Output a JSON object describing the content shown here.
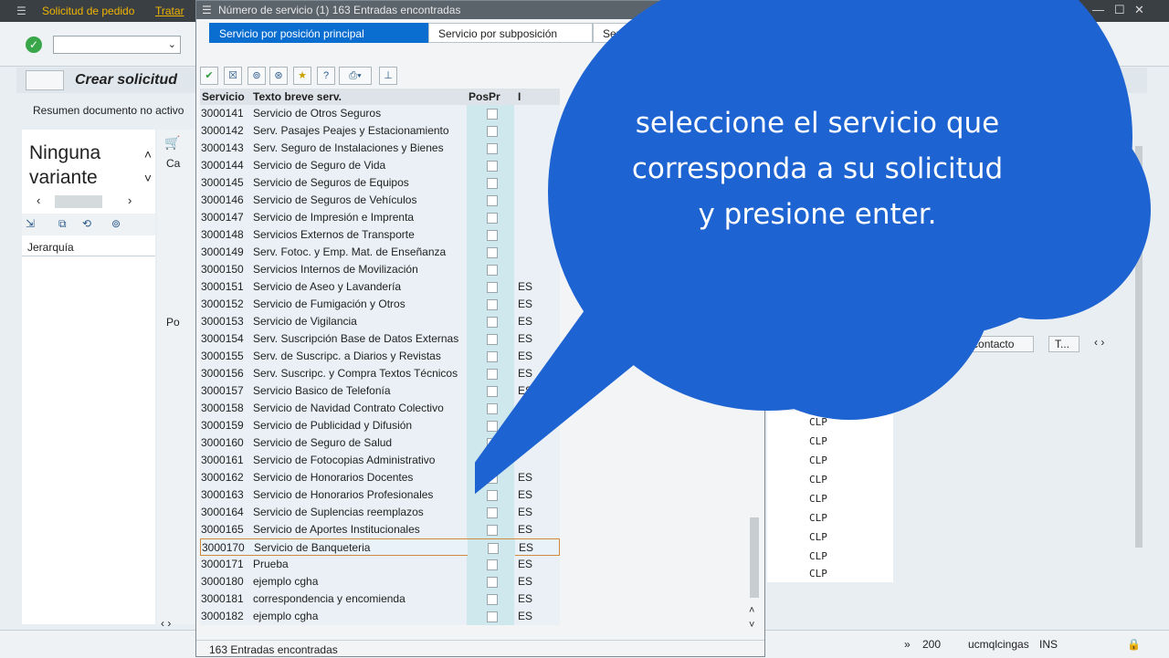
{
  "menu": {
    "items": [
      "Solicitud de pedido",
      "Tratar"
    ]
  },
  "window_controls": {
    "minimize": "—",
    "maximize": "☐",
    "close": "✕"
  },
  "main": {
    "title": "Crear solicitud",
    "summary_text": "Resumen documento no activo",
    "variant_text": "Ninguna variante",
    "hierarchy_label": "Jerarquía",
    "side_labels": [
      "Ca",
      "Po"
    ]
  },
  "right_tabs": [
    "ona de contacto",
    "T..."
  ],
  "currency_rows": [
    "CLP",
    "CLP",
    "CLP",
    "CLP",
    "CLP",
    "CLP",
    "CLP",
    "CLP",
    "CLP"
  ],
  "footer": {
    "zoom": "200",
    "user": "ucmqlcingas",
    "mode": "INS"
  },
  "dialog": {
    "title": "Número de servicio (1)  163 Entradas encontradas",
    "tabs": [
      "Servicio por posición principal",
      "Servicio por subposición",
      "Servicio por..."
    ],
    "columns": {
      "servicio": "Servicio",
      "texto": "Texto breve serv.",
      "pospr": "PosPr",
      "idioma": "I"
    },
    "rows": [
      {
        "id": "3000141",
        "text": "Servicio de Otros Seguros",
        "lang": ""
      },
      {
        "id": "3000142",
        "text": "Serv. Pasajes Peajes y Estacionamiento",
        "lang": ""
      },
      {
        "id": "3000143",
        "text": "Serv. Seguro de Instalaciones y Bienes",
        "lang": ""
      },
      {
        "id": "3000144",
        "text": "Servicio de Seguro de Vida",
        "lang": ""
      },
      {
        "id": "3000145",
        "text": "Servicio de Seguros de Equipos",
        "lang": ""
      },
      {
        "id": "3000146",
        "text": "Servicio de Seguros de Vehículos",
        "lang": ""
      },
      {
        "id": "3000147",
        "text": "Servicio de Impresión e Imprenta",
        "lang": ""
      },
      {
        "id": "3000148",
        "text": "Servicios Externos de Transporte",
        "lang": ""
      },
      {
        "id": "3000149",
        "text": "Serv. Fotoc.  y Emp. Mat.  de Enseñanza",
        "lang": ""
      },
      {
        "id": "3000150",
        "text": "Servicios Internos de Movilización",
        "lang": ""
      },
      {
        "id": "3000151",
        "text": "Servicio de Aseo y Lavandería",
        "lang": "ES"
      },
      {
        "id": "3000152",
        "text": "Servicio de Fumigación y Otros",
        "lang": "ES"
      },
      {
        "id": "3000153",
        "text": "Servicio de Vigilancia",
        "lang": "ES"
      },
      {
        "id": "3000154",
        "text": "Serv. Suscripción Base de Datos Externas",
        "lang": "ES"
      },
      {
        "id": "3000155",
        "text": "Serv. de Suscripc. a Diarios y Revistas",
        "lang": "ES"
      },
      {
        "id": "3000156",
        "text": "Serv. Suscripc. y Compra Textos Técnicos",
        "lang": "ES"
      },
      {
        "id": "3000157",
        "text": "Servicio Basico de Telefonía",
        "lang": "ES"
      },
      {
        "id": "3000158",
        "text": "Servicio de Navidad Contrato Colectivo",
        "lang": "ES"
      },
      {
        "id": "3000159",
        "text": "Servicio de Publicidad y Difusión",
        "lang": "ES"
      },
      {
        "id": "3000160",
        "text": "Servicio de Seguro de Salud",
        "lang": ""
      },
      {
        "id": "3000161",
        "text": "Servicio de Fotocopias Administrativo",
        "lang": ""
      },
      {
        "id": "3000162",
        "text": "Servicio de Honorarios Docentes",
        "lang": "ES"
      },
      {
        "id": "3000163",
        "text": "Servicio de Honorarios Profesionales",
        "lang": "ES"
      },
      {
        "id": "3000164",
        "text": "Servicio de Suplencias reemplazos",
        "lang": "ES"
      },
      {
        "id": "3000165",
        "text": "Servicio de Aportes Institucionales",
        "lang": "ES"
      },
      {
        "id": "3000170",
        "text": "Servicio de Banqueteria",
        "lang": "ES"
      },
      {
        "id": "3000171",
        "text": "Prueba",
        "lang": "ES"
      },
      {
        "id": "3000180",
        "text": "ejemplo cgha",
        "lang": "ES"
      },
      {
        "id": "3000181",
        "text": "correspondencia y encomienda",
        "lang": "ES"
      },
      {
        "id": "3000182",
        "text": "ejemplo cgha",
        "lang": "ES"
      }
    ],
    "selected_row": 25,
    "footer_text": "163 Entradas encontradas"
  },
  "bubble": {
    "text": "seleccione el servicio que corresponda a su solicitud y presione enter.",
    "color": "#1e63d2"
  }
}
